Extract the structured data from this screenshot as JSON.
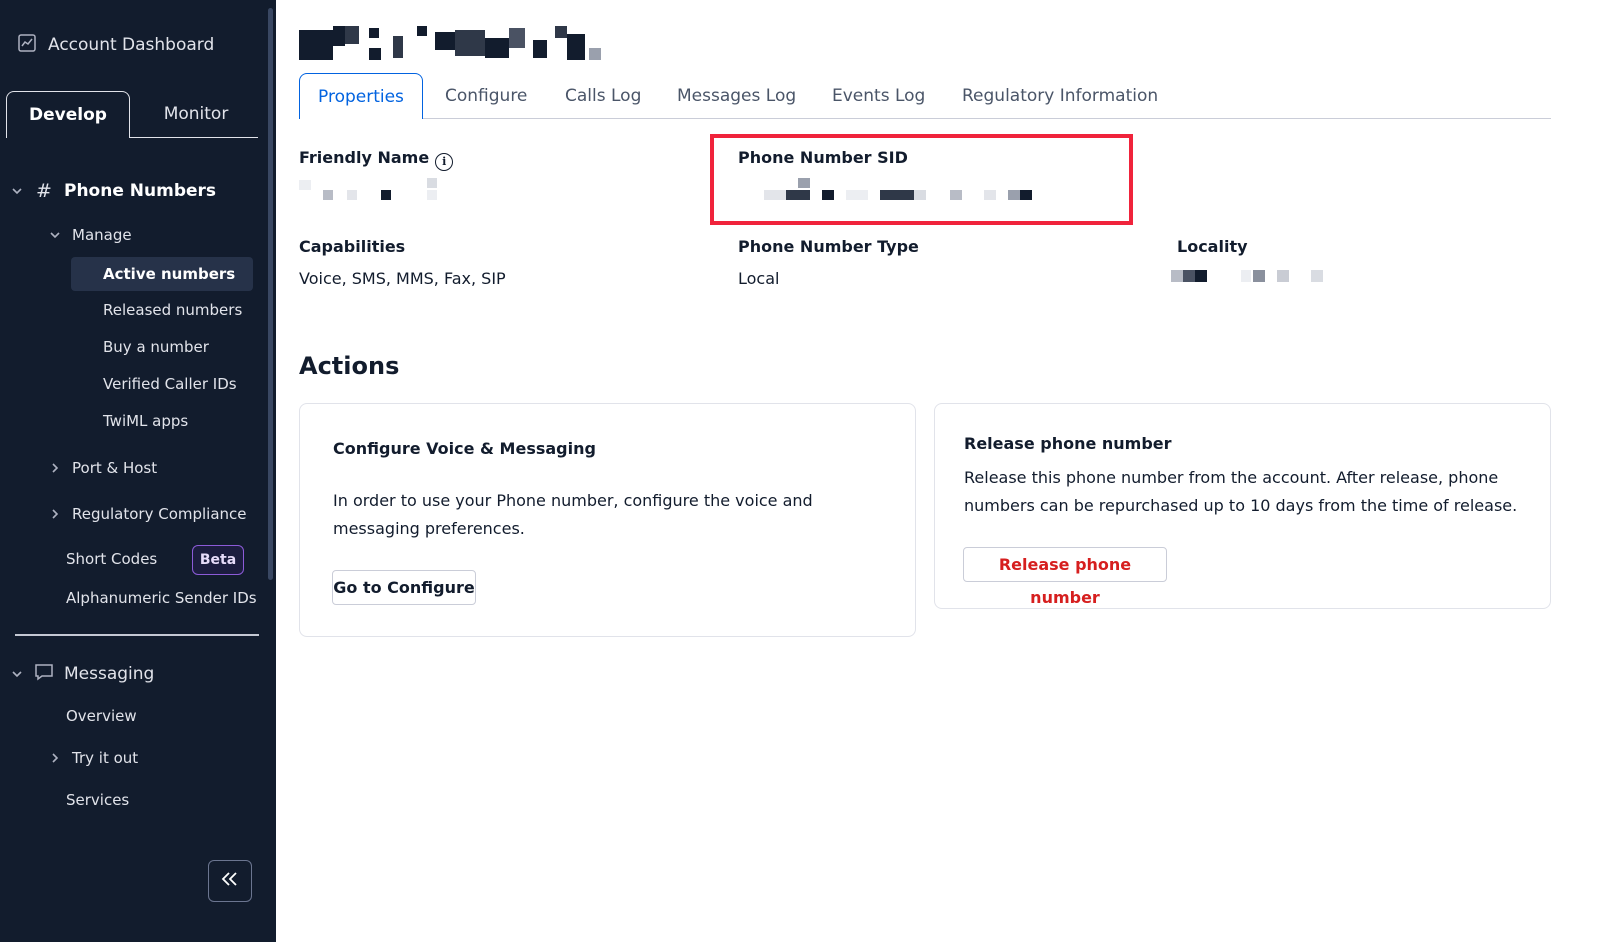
{
  "sidebar": {
    "account_dashboard": "Account Dashboard",
    "tabs": {
      "develop": "Develop",
      "monitor": "Monitor"
    },
    "phone_numbers": {
      "label": "Phone Numbers",
      "manage": {
        "label": "Manage",
        "items": [
          "Active numbers",
          "Released numbers",
          "Buy a number",
          "Verified Caller IDs",
          "TwiML apps"
        ]
      },
      "port_host": "Port & Host",
      "regulatory_compliance": "Regulatory Compliance",
      "short_codes": "Short Codes",
      "short_codes_badge": "Beta",
      "alphanumeric": "Alphanumeric Sender IDs"
    },
    "messaging": {
      "label": "Messaging",
      "overview": "Overview",
      "try_it_out": "Try it out",
      "services": "Services"
    }
  },
  "tabs": [
    "Properties",
    "Configure",
    "Calls Log",
    "Messages Log",
    "Events Log",
    "Regulatory Information"
  ],
  "properties": {
    "friendly_name_label": "Friendly Name",
    "phone_sid_label": "Phone Number SID",
    "capabilities_label": "Capabilities",
    "capabilities_value": "Voice, SMS, MMS, Fax, SIP",
    "type_label": "Phone Number Type",
    "type_value": "Local",
    "locality_label": "Locality"
  },
  "actions": {
    "title": "Actions",
    "configure_card": {
      "title": "Configure Voice & Messaging",
      "text": "In order to use your Phone number, configure the voice and messaging preferences.",
      "button": "Go to Configure"
    },
    "release_card": {
      "title": "Release phone number",
      "text": "Release this phone number from the account. After release, phone numbers can be repurchased up to 10 days from the time of release.",
      "button": "Release phone number"
    }
  },
  "colors": {
    "sidebar_bg": "#121c2d",
    "accent_blue": "#0263e0",
    "highlight_red": "#f0233b",
    "danger_red": "#d61f1f",
    "beta_purple": "#8c5bd8"
  }
}
